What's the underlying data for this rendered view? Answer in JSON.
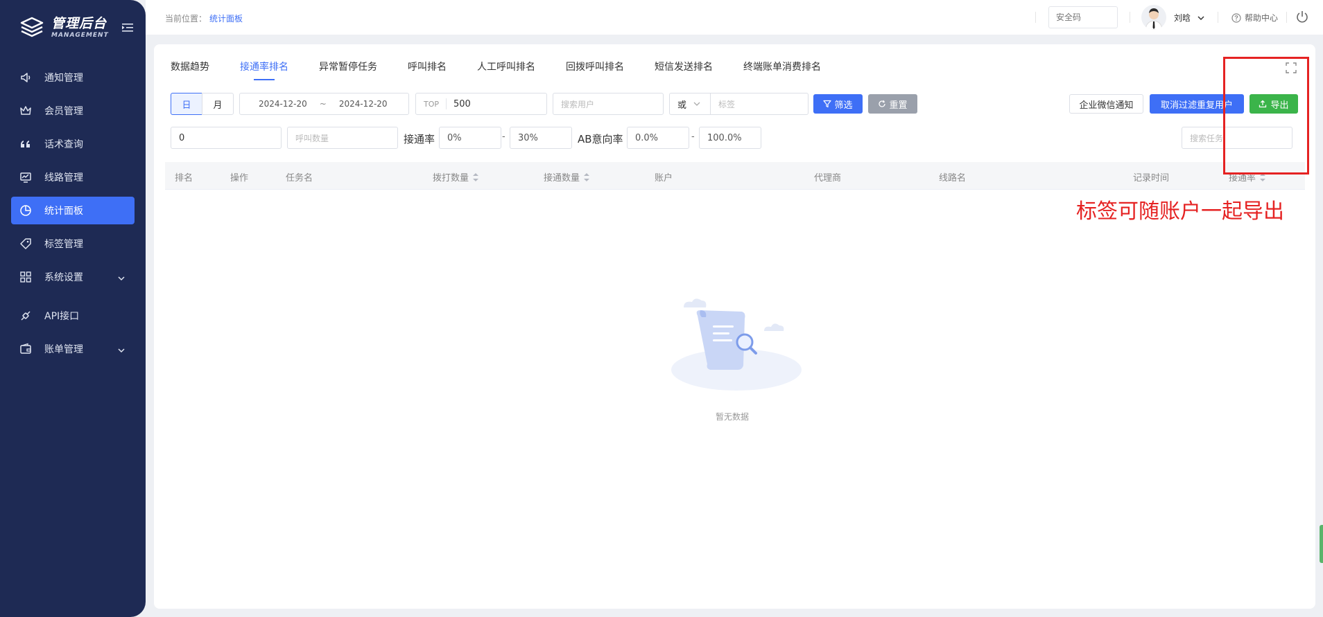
{
  "app": {
    "title": "管理后台",
    "subtitle": "MANAGEMENT"
  },
  "sidebar": {
    "items": [
      {
        "label": "通知管理",
        "icon": "speaker-icon"
      },
      {
        "label": "会员管理",
        "icon": "crown-icon"
      },
      {
        "label": "话术查询",
        "icon": "quote-icon"
      },
      {
        "label": "线路管理",
        "icon": "monitor-icon"
      },
      {
        "label": "统计面板",
        "icon": "pie-chart-icon",
        "active": true
      },
      {
        "label": "标签管理",
        "icon": "tag-icon"
      },
      {
        "label": "系统设置",
        "icon": "grid-icon",
        "has_children": true
      },
      {
        "label": "API接口",
        "icon": "plug-icon"
      },
      {
        "label": "账单管理",
        "icon": "wallet-icon",
        "has_children": true
      }
    ]
  },
  "header": {
    "breadcrumb_prefix": "当前位置：",
    "breadcrumb_current": "统计面板",
    "security_placeholder": "安全码",
    "user_name": "刘晗",
    "help": "帮助中心"
  },
  "tabs": [
    {
      "label": "数据趋势"
    },
    {
      "label": "接通率排名",
      "active": true
    },
    {
      "label": "异常暂停任务"
    },
    {
      "label": "呼叫排名"
    },
    {
      "label": "人工呼叫排名"
    },
    {
      "label": "回拨呼叫排名"
    },
    {
      "label": "短信发送排名"
    },
    {
      "label": "终端账单消费排名"
    }
  ],
  "filters": {
    "day": "日",
    "month": "月",
    "date_start": "2024-12-20",
    "date_sep": "~",
    "date_end": "2024-12-20",
    "top_label": "TOP",
    "top_value": "500",
    "search_user_placeholder": "搜索用户",
    "logic_value": "或",
    "tag_placeholder": "标签",
    "filter_button": "筛选",
    "reset_button": "重置",
    "wechat_notify": "企业微信通知",
    "cancel_dedupe": "取消过滤重复用户",
    "export_button": "导出",
    "min_value": "0",
    "call_count_placeholder": "呼叫数量",
    "connect_rate_label": "接通率",
    "connect_rate_min": "0%",
    "connect_rate_max": "30%",
    "ab_intent_label": "AB意向率",
    "ab_min": "0.0%",
    "ab_max": "100.0%",
    "range_dash": "-",
    "search_task_placeholder": "搜索任务"
  },
  "table": {
    "columns": [
      "排名",
      "操作",
      "任务名",
      "拨打数量",
      "接通数量",
      "账户",
      "代理商",
      "线路名",
      "记录时间",
      "接通率"
    ],
    "empty_text": "暂无数据"
  },
  "annotation": {
    "note": "标签可随账户一起导出",
    "color": "#e52222"
  },
  "colors": {
    "sidebar_bg": "#1e2a54",
    "accent": "#3e6ff6",
    "export_green": "#3bb44a",
    "reset_gray": "#9aa0ab"
  }
}
